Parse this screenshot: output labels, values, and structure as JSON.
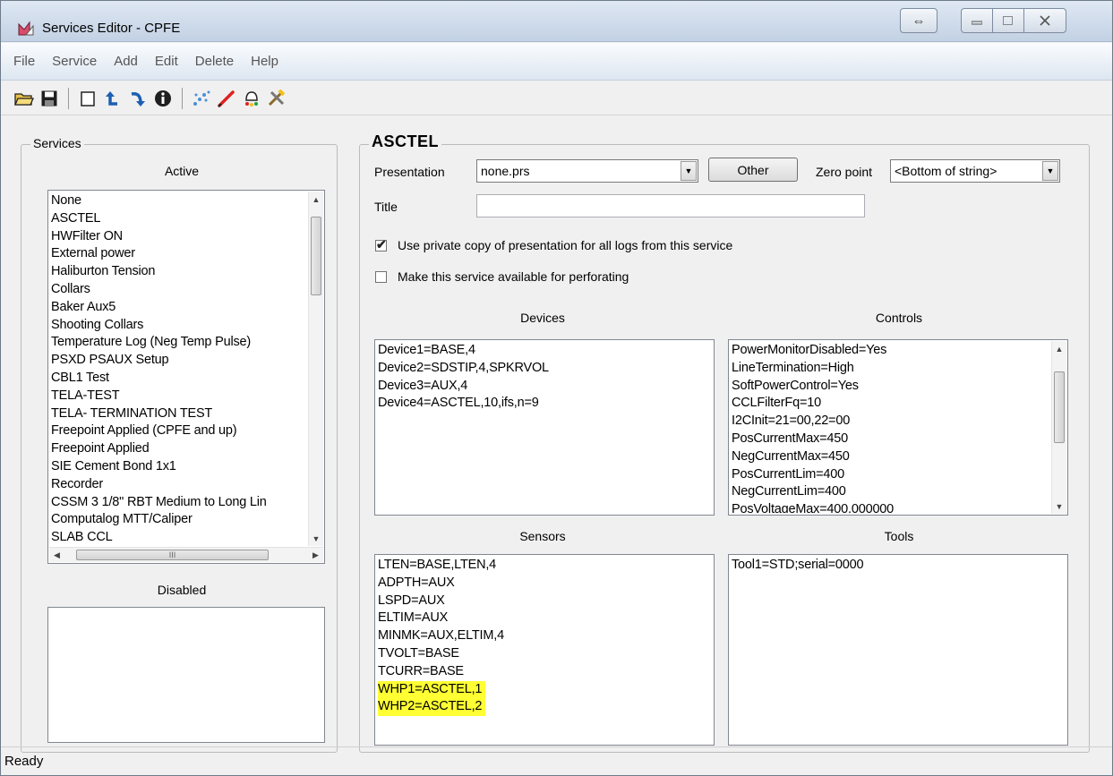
{
  "window": {
    "title": "Services Editor - CPFE"
  },
  "menu": [
    "File",
    "Service",
    "Add",
    "Edit",
    "Delete",
    "Help"
  ],
  "toolbar": [
    {
      "icon": "open-folder-icon"
    },
    {
      "icon": "save-icon"
    },
    {
      "icon": "new-document-icon"
    },
    {
      "icon": "undo-icon"
    },
    {
      "icon": "redo-icon"
    },
    {
      "icon": "info-icon"
    },
    {
      "icon": "sparkle-icon"
    },
    {
      "icon": "red-pen-icon"
    },
    {
      "icon": "bell-icon"
    },
    {
      "icon": "tools-icon"
    }
  ],
  "services": {
    "group_title": "Services",
    "active_label": "Active",
    "disabled_label": "Disabled",
    "active_items": [
      "None",
      "ASCTEL",
      "HWFilter ON",
      "External power",
      "Haliburton Tension",
      "Collars",
      "Baker Aux5",
      "Shooting Collars",
      "Temperature Log (Neg Temp Pulse)",
      "PSXD PSAUX Setup",
      "CBL1 Test",
      "TELA-TEST",
      "TELA- TERMINATION TEST",
      "Freepoint Applied (CPFE and up)",
      "Freepoint Applied",
      "SIE Cement Bond 1x1",
      "Recorder",
      "CSSM 3 1/8\" RBT Medium to Long Lin",
      "Computalog MTT/Caliper",
      "SLAB CCL"
    ],
    "hscroll_grip": "III"
  },
  "service": {
    "name": "ASCTEL",
    "presentation_label": "Presentation",
    "presentation_value": "none.prs",
    "other_button": "Other",
    "zero_point_label": "Zero point",
    "zero_point_value": "<Bottom of string>",
    "title_label": "Title",
    "title_value": "",
    "private_copy_label": "Use private copy of presentation for all logs from this service",
    "private_copy_checked": true,
    "perforating_label": "Make this service available for perforating",
    "perforating_checked": false,
    "devices_label": "Devices",
    "controls_label": "Controls",
    "sensors_label": "Sensors",
    "tools_label": "Tools",
    "devices": [
      "Device1=BASE,4",
      "Device2=SDSTIP,4,SPKRVOL",
      "Device3=AUX,4",
      "Device4=ASCTEL,10,ifs,n=9"
    ],
    "controls": [
      "PowerMonitorDisabled=Yes",
      "LineTermination=High",
      "SoftPowerControl=Yes",
      "CCLFilterFq=10",
      "I2CInit=21=00,22=00",
      "PosCurrentMax=450",
      "NegCurrentMax=450",
      "PosCurrentLim=400",
      "NegCurrentLim=400",
      "PosVoltageMax=400.000000"
    ],
    "sensors": [
      "LTEN=BASE,LTEN,4",
      "ADPTH=AUX",
      "LSPD=AUX",
      "ELTIM=AUX",
      "MINMK=AUX,ELTIM,4",
      "TVOLT=BASE",
      "TCURR=BASE",
      "WHP1=ASCTEL,1",
      "WHP2=ASCTEL,2"
    ],
    "highlighted_sensors": [
      "WHP1=ASCTEL,1",
      "WHP2=ASCTEL,2"
    ],
    "highlight_color": "#ffff33",
    "tools": [
      "Tool1=STD;serial=0000"
    ]
  },
  "status": {
    "text": "Ready"
  }
}
